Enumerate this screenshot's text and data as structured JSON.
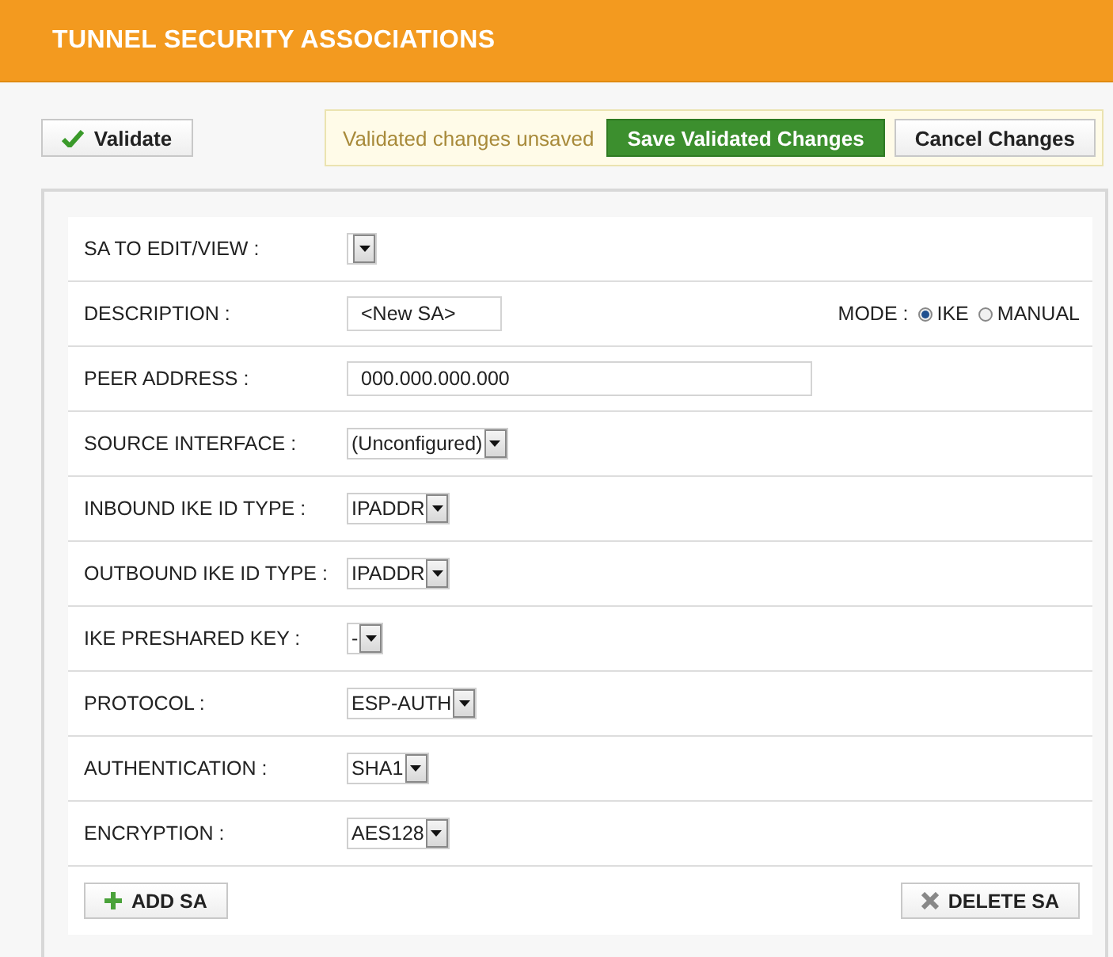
{
  "header": {
    "title": "TUNNEL SECURITY ASSOCIATIONS"
  },
  "toolbar": {
    "validate": "Validate",
    "notice": "Validated changes unsaved",
    "save": "Save Validated Changes",
    "cancel": "Cancel Changes"
  },
  "form": {
    "rows": [
      {
        "label": "SA TO EDIT/VIEW :",
        "kind": "select"
      },
      {
        "label": "DESCRIPTION :",
        "kind": "text",
        "value": "<New SA>",
        "mode": {
          "label": "MODE :",
          "options": [
            {
              "label": "IKE",
              "selected": true
            },
            {
              "label": "MANUAL",
              "selected": false
            }
          ]
        }
      },
      {
        "label": "PEER ADDRESS :",
        "kind": "text",
        "value": "000.000.000.000"
      },
      {
        "label": "SOURCE INTERFACE :",
        "kind": "select",
        "value": "(Unconfigured)"
      },
      {
        "label": "INBOUND IKE ID TYPE :",
        "kind": "select",
        "value": "IPADDR"
      },
      {
        "label": "OUTBOUND IKE ID TYPE :",
        "kind": "select",
        "value": "IPADDR"
      },
      {
        "label": "IKE PRESHARED KEY :",
        "kind": "select",
        "value": "-"
      },
      {
        "label": "PROTOCOL :",
        "kind": "select",
        "value": "ESP-AUTH"
      },
      {
        "label": "AUTHENTICATION :",
        "kind": "select",
        "value": "SHA1"
      },
      {
        "label": "ENCRYPTION :",
        "kind": "select",
        "value": "AES128"
      }
    ],
    "add": "ADD SA",
    "delete": "DELETE SA"
  }
}
